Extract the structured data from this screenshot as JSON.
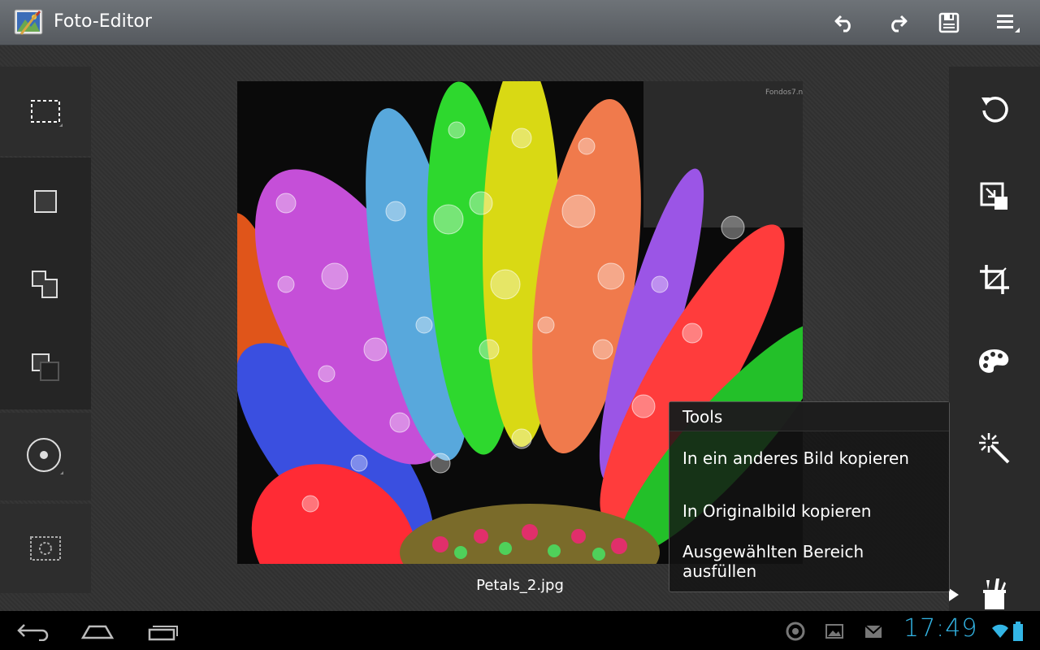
{
  "app": {
    "title": "Foto-Editor"
  },
  "actionbar": {
    "buttons": [
      "undo-icon",
      "redo-icon",
      "save-icon",
      "menu-icon"
    ]
  },
  "left_tools": [
    "rect-select-icon",
    "new-selection-icon",
    "add-selection-icon",
    "subtract-selection-icon",
    "radial-select-icon",
    "selection-border-icon"
  ],
  "right_tools": [
    "rotate-icon",
    "resize-icon",
    "crop-icon",
    "palette-icon",
    "magic-wand-icon",
    "tools-icon"
  ],
  "canvas": {
    "filename": "Petals_2.jpg",
    "watermark": "Fondos7.n"
  },
  "popup": {
    "title": "Tools",
    "items": [
      "In ein anderes Bild kopieren",
      "In Originalbild kopieren",
      "Ausgewählten Bereich ausfüllen"
    ]
  },
  "statusbar": {
    "time": "17:49"
  },
  "colors": {
    "accent": "#33b5e5",
    "actionbar": "#5f6368"
  }
}
